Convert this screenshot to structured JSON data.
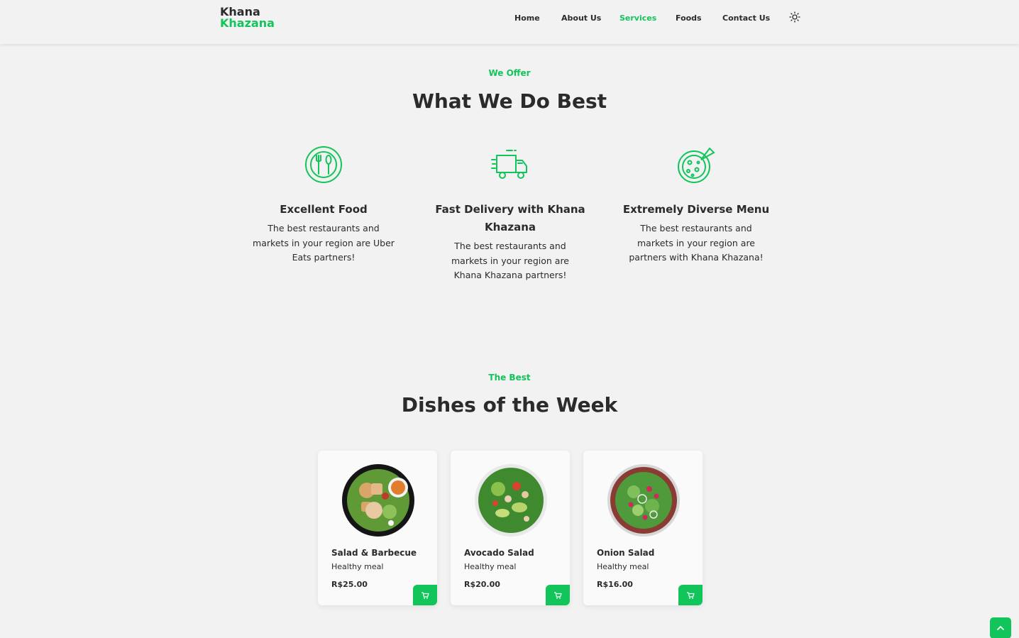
{
  "brand": {
    "line1": "Khana",
    "line2": "Khazana"
  },
  "nav": {
    "items": [
      {
        "label": "Home"
      },
      {
        "label": "About Us"
      },
      {
        "label": "Services",
        "active": true
      },
      {
        "label": "Foods"
      },
      {
        "label": "Contact Us"
      }
    ],
    "theme_icon": "sun-icon"
  },
  "colors": {
    "accent": "#11c55b",
    "text": "#2b2b2b",
    "background": "#f2f2f2"
  },
  "services": {
    "subtitle": "We Offer",
    "title": "What We Do Best",
    "items": [
      {
        "icon": "food-plate-icon",
        "title": "Excellent Food",
        "text": "The best restaurants and markets in your region are Uber Eats partners!"
      },
      {
        "icon": "delivery-truck-icon",
        "title": "Fast Delivery with Khana Khazana",
        "text": "The best restaurants and markets in your region are Khana Khazana partners!"
      },
      {
        "icon": "pizza-icon",
        "title": "Extremely Diverse Menu",
        "text": "The best restaurants and markets in your region are partners with Khana Khazana!"
      }
    ]
  },
  "dishes": {
    "subtitle": "The Best",
    "title": "Dishes of the Week",
    "items": [
      {
        "name": "Salad & Barbecue",
        "desc": "Healthy meal",
        "price": "R$25.00",
        "cart_icon": "cart-icon"
      },
      {
        "name": "Avocado Salad",
        "desc": "Healthy meal",
        "price": "R$20.00",
        "cart_icon": "cart-icon"
      },
      {
        "name": "Onion Salad",
        "desc": "Healthy meal",
        "price": "R$16.00",
        "cart_icon": "cart-icon"
      }
    ]
  },
  "scroll_top_icon": "chevron-up-icon"
}
